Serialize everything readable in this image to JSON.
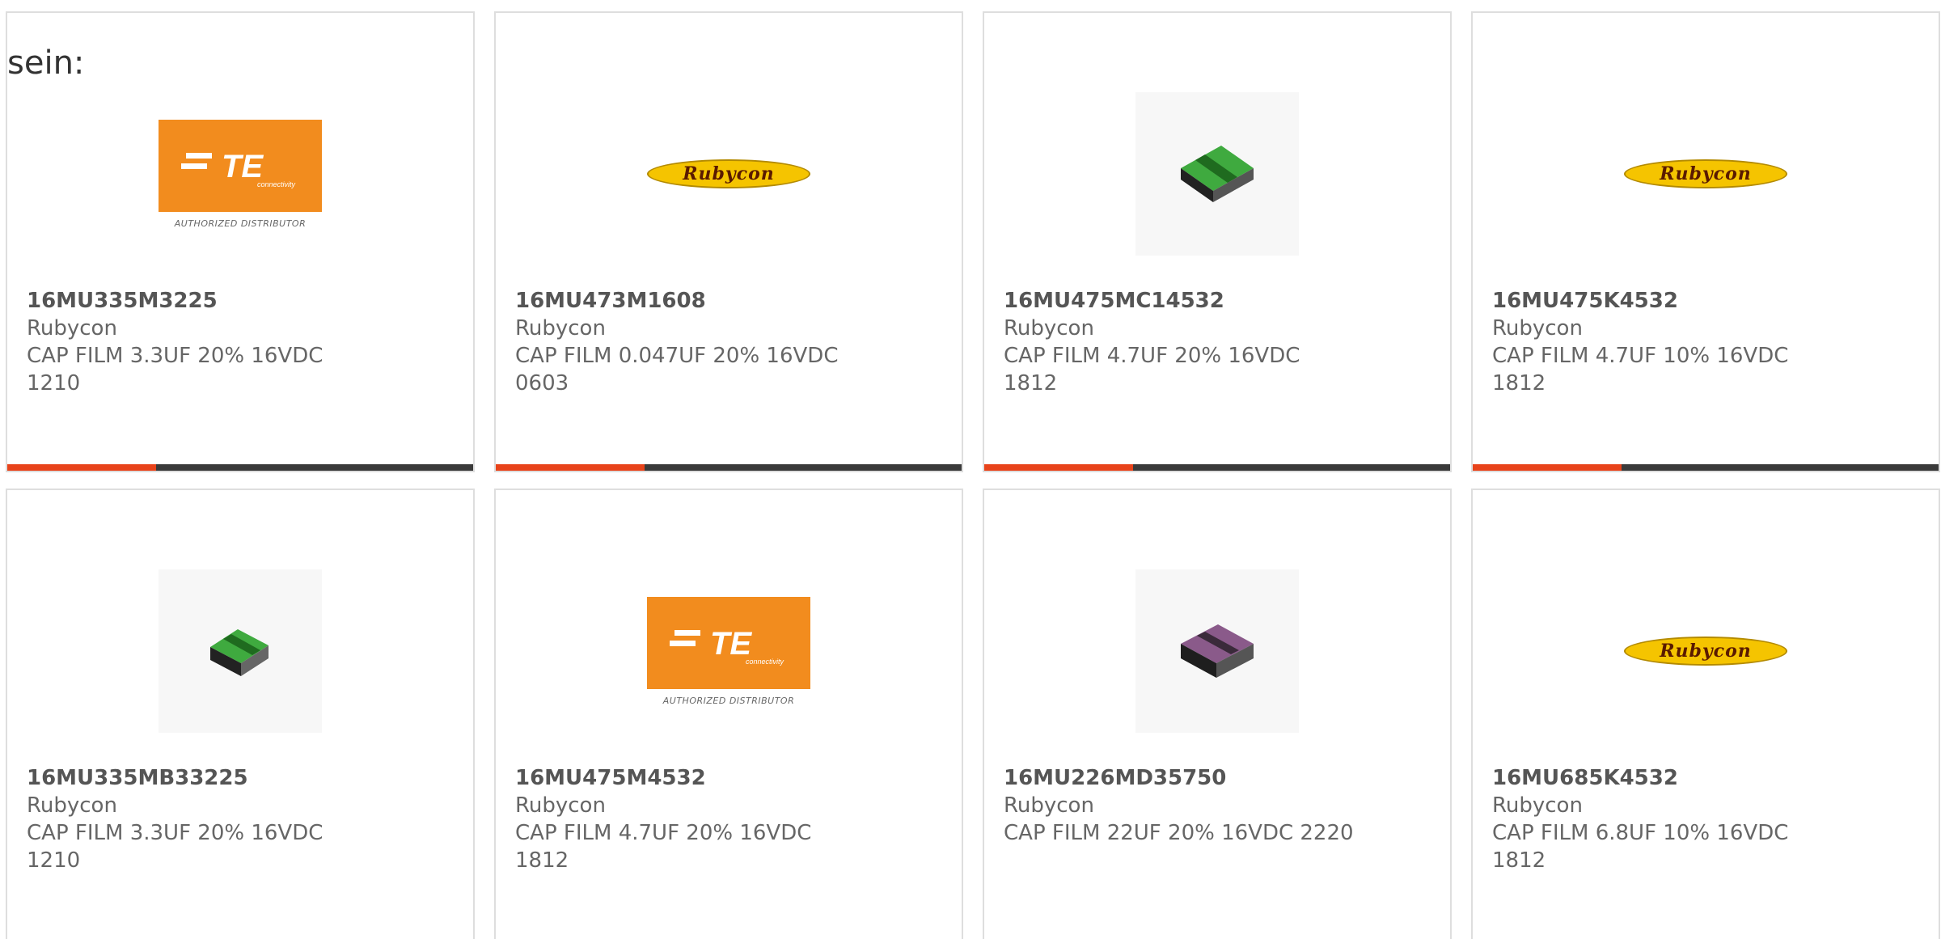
{
  "intro_text": "sein:",
  "colors": {
    "accent": "#e8431a",
    "bar": "#3a3a3a",
    "te_orange": "#f28c1e",
    "rubycon_yellow": "#f5c400"
  },
  "brands": {
    "te": {
      "main": "TE",
      "small": "connectivity",
      "sub": "AUTHORIZED DISTRIBUTOR"
    },
    "rubycon": {
      "name": "Rubycon"
    }
  },
  "cards": [
    {
      "part_number": "16MU335M3225",
      "manufacturer": "Rubycon",
      "description": "CAP FILM 3.3UF 20% 16VDC\n1210",
      "image": "te-logo"
    },
    {
      "part_number": "16MU473M1608",
      "manufacturer": "Rubycon",
      "description": "CAP FILM 0.047UF 20% 16VDC\n0603",
      "image": "rubycon-logo"
    },
    {
      "part_number": "16MU475MC14532",
      "manufacturer": "Rubycon",
      "description": "CAP FILM 4.7UF 20% 16VDC\n1812",
      "image": "green-chip"
    },
    {
      "part_number": "16MU475K4532",
      "manufacturer": "Rubycon",
      "description": "CAP FILM 4.7UF 10% 16VDC\n1812",
      "image": "rubycon-logo"
    },
    {
      "part_number": "16MU335MB33225",
      "manufacturer": "Rubycon",
      "description": "CAP FILM 3.3UF 20% 16VDC\n1210",
      "image": "green-chip"
    },
    {
      "part_number": "16MU475M4532",
      "manufacturer": "Rubycon",
      "description": "CAP FILM 4.7UF 20% 16VDC\n1812",
      "image": "te-logo"
    },
    {
      "part_number": "16MU226MD35750",
      "manufacturer": "Rubycon",
      "description": "CAP FILM 22UF 20% 16VDC 2220",
      "image": "purple-chip"
    },
    {
      "part_number": "16MU685K4532",
      "manufacturer": "Rubycon",
      "description": "CAP FILM 6.8UF 10% 16VDC\n1812",
      "image": "rubycon-logo"
    }
  ]
}
